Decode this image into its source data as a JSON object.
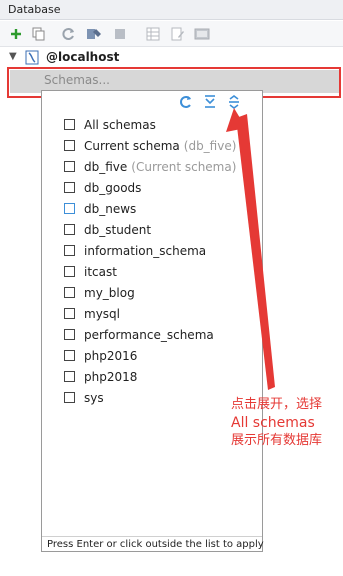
{
  "panel": {
    "title": "Database"
  },
  "toolbar": {
    "buttons": [
      "add-icon",
      "copy-icon",
      "refresh-icon",
      "properties-icon",
      "stop-icon",
      "table-icon",
      "edit-icon",
      "console-icon"
    ]
  },
  "tree": {
    "connection": "@localhost",
    "schemas_placeholder": "Schemas..."
  },
  "popup": {
    "toolbar": [
      "refresh-icon",
      "expand-all-icon",
      "collapse-all-icon"
    ],
    "items": [
      {
        "label": "All schemas",
        "hint": ""
      },
      {
        "label": "Current schema",
        "hint": "(db_five)"
      },
      {
        "label": "db_five",
        "hint": "(Current schema)"
      },
      {
        "label": "db_goods",
        "hint": ""
      },
      {
        "label": "db_news",
        "hint": ""
      },
      {
        "label": "db_student",
        "hint": ""
      },
      {
        "label": "information_schema",
        "hint": ""
      },
      {
        "label": "itcast",
        "hint": ""
      },
      {
        "label": "my_blog",
        "hint": ""
      },
      {
        "label": "mysql",
        "hint": ""
      },
      {
        "label": "performance_schema",
        "hint": ""
      },
      {
        "label": "php2016",
        "hint": ""
      },
      {
        "label": "php2018",
        "hint": ""
      },
      {
        "label": "sys",
        "hint": ""
      }
    ],
    "footer": "Press Enter or click outside the list to apply"
  },
  "annotation": {
    "line1": "点击展开，选择",
    "line2": "All schemas",
    "line3": "展示所有数据库"
  },
  "colors": {
    "annotation": "#e53935",
    "accent": "#3d8fd8",
    "add_green": "#2e9b2e"
  }
}
